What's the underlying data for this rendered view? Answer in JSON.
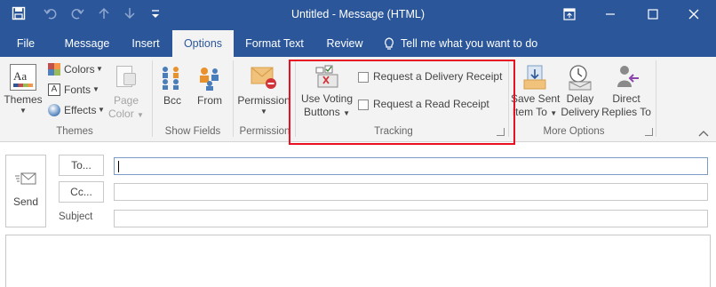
{
  "window": {
    "title": "Untitled - Message (HTML)"
  },
  "qat": {
    "save": "save-icon",
    "undo": "undo-icon",
    "redo": "redo-icon",
    "up": "up-arrow-icon",
    "down": "down-arrow-icon",
    "customize": "customize-icon"
  },
  "tabs": [
    {
      "label": "File"
    },
    {
      "label": "Message"
    },
    {
      "label": "Insert"
    },
    {
      "label": "Options"
    },
    {
      "label": "Format Text"
    },
    {
      "label": "Review"
    }
  ],
  "tell_me": "Tell me what you want to do",
  "ribbon": {
    "themes": {
      "themes_line1": "Themes",
      "colors": "Colors",
      "fonts": "Fonts",
      "effects": "Effects",
      "page_line1": "Page",
      "page_line2": "Color",
      "group_label": "Themes"
    },
    "show_fields": {
      "bcc": "Bcc",
      "from": "From",
      "group_label": "Show Fields"
    },
    "permission": {
      "label": "Permission",
      "group_label": "Permission"
    },
    "tracking": {
      "voting_line1": "Use Voting",
      "voting_line2": "Buttons",
      "delivery": "Request a Delivery Receipt",
      "read": "Request a Read Receipt",
      "group_label": "Tracking"
    },
    "more_options": {
      "save_line1": "Save Sent",
      "save_line2": "Item To",
      "delay_line1": "Delay",
      "delay_line2": "Delivery",
      "direct_line1": "Direct",
      "direct_line2": "Replies To",
      "group_label": "More Options"
    }
  },
  "compose": {
    "send": "Send",
    "to": "To...",
    "cc": "Cc...",
    "subject": "Subject"
  },
  "colors": {
    "accent": "#2b579a",
    "highlight": "#e81123"
  }
}
